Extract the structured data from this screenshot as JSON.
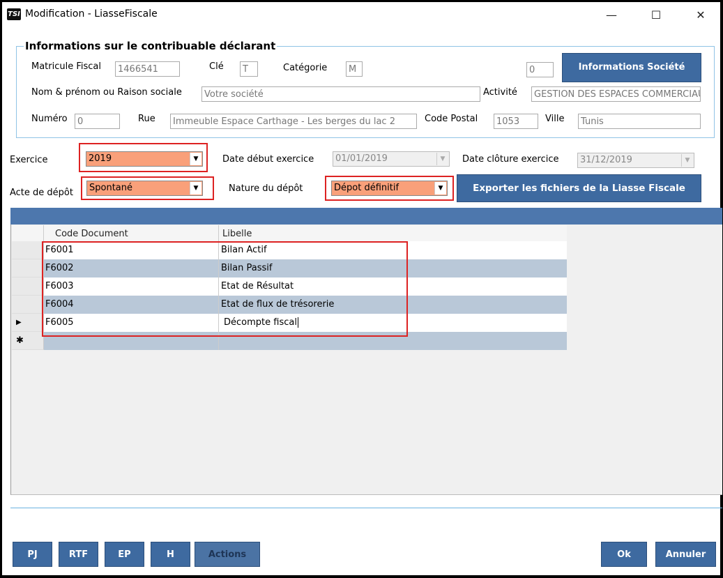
{
  "window": {
    "logo": "TSI",
    "title": "Modification - LiasseFiscale",
    "minimize": "—",
    "maximize": "☐",
    "close": "✕"
  },
  "taxpayer": {
    "group_title": "Informations sur le contribuable déclarant",
    "matricule_label": "Matricule Fiscal",
    "matricule_value": "1466541",
    "cle_label": "Clé",
    "cle_value": "T",
    "categorie_label": "Catégorie",
    "categorie_value": "M",
    "unnamed_value": "0",
    "info_button": "Informations Société",
    "nom_label": "Nom & prénom ou Raison sociale",
    "nom_value": "Votre société",
    "activite_label": "Activité",
    "activite_value": "GESTION DES ESPACES COMMERCIAUX",
    "numero_label": "Numéro",
    "numero_value": "0",
    "rue_label": "Rue",
    "rue_value": "Immeuble Espace Carthage - Les berges du lac 2",
    "cp_label": "Code Postal",
    "cp_value": "1053",
    "ville_label": "Ville",
    "ville_value": "Tunis"
  },
  "exercise": {
    "exercice_label": "Exercice",
    "exercice_value": "2019",
    "debut_label": "Date début exercice",
    "debut_value": "01/01/2019",
    "cloture_label": "Date clôture exercice",
    "cloture_value": "31/12/2019",
    "acte_label": "Acte de dépôt",
    "acte_value": "Spontané",
    "nature_label": "Nature du dépôt",
    "nature_value": "Dépot définitif",
    "export_button": "Exporter les fichiers de la Liasse Fiscale"
  },
  "grid": {
    "columns": [
      "Code Document",
      "Libelle"
    ],
    "rows": [
      {
        "code": "F6001",
        "libelle": "Bilan Actif"
      },
      {
        "code": "F6002",
        "libelle": "Bilan Passif"
      },
      {
        "code": "F6003",
        "libelle": "Etat de Résultat"
      },
      {
        "code": "F6004",
        "libelle": "Etat de flux de trésorerie"
      },
      {
        "code": "F6005",
        "libelle": "Décompte fiscal"
      }
    ],
    "current_marker": "▶",
    "new_marker": "✱"
  },
  "footer": {
    "buttons": [
      "PJ",
      "RTF",
      "EP",
      "H",
      "Actions"
    ],
    "ok": "Ok",
    "cancel": "Annuler"
  },
  "colors": {
    "accent_blue": "#3e6aa0",
    "highlight_orange": "#f9a07a",
    "annotation_red": "#d22222",
    "alt_row": "#b9c8d8"
  }
}
